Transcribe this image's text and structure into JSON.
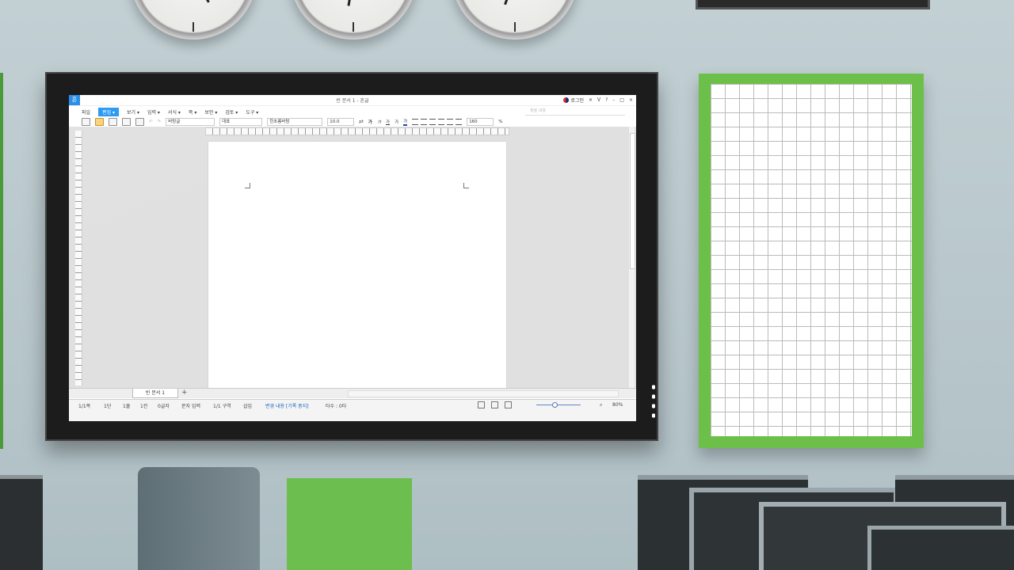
{
  "window": {
    "title": "빈 문서 1 - 흔글",
    "logo": "흔",
    "login": "로그인",
    "controls": [
      "ᐯ",
      "?",
      "–",
      "□",
      "×"
    ]
  },
  "menus": [
    "파일",
    "편집 ▾",
    "보기 ▾",
    "입력 ▾",
    "서식 ▾",
    "쪽 ▾",
    "보안 ▾",
    "검토 ▾",
    "도구 ▾"
  ],
  "active_menu": 1,
  "search": {
    "placeholder": "찾을 내용"
  },
  "toolbar": {
    "style": "바탕글",
    "lang": "대표",
    "font": "한초롬바탕",
    "size": "10.0",
    "unit": "pt",
    "linespacing": "160",
    "percent": "%",
    "char_buttons": [
      "가",
      "가",
      "가",
      "가",
      "가"
    ]
  },
  "tabs": {
    "doc": "빈 문서 1",
    "add": "+"
  },
  "status": {
    "page": "1/1쪽",
    "col": "1단",
    "line": "1줄",
    "cell": "1칸",
    "chars": "0글자",
    "input": "문자 입력",
    "section": "1/1 구역",
    "mode": "삽입",
    "track": "변경 내용 [기록 중지]",
    "typing": "타수 : 0타",
    "zoom": "80%"
  }
}
